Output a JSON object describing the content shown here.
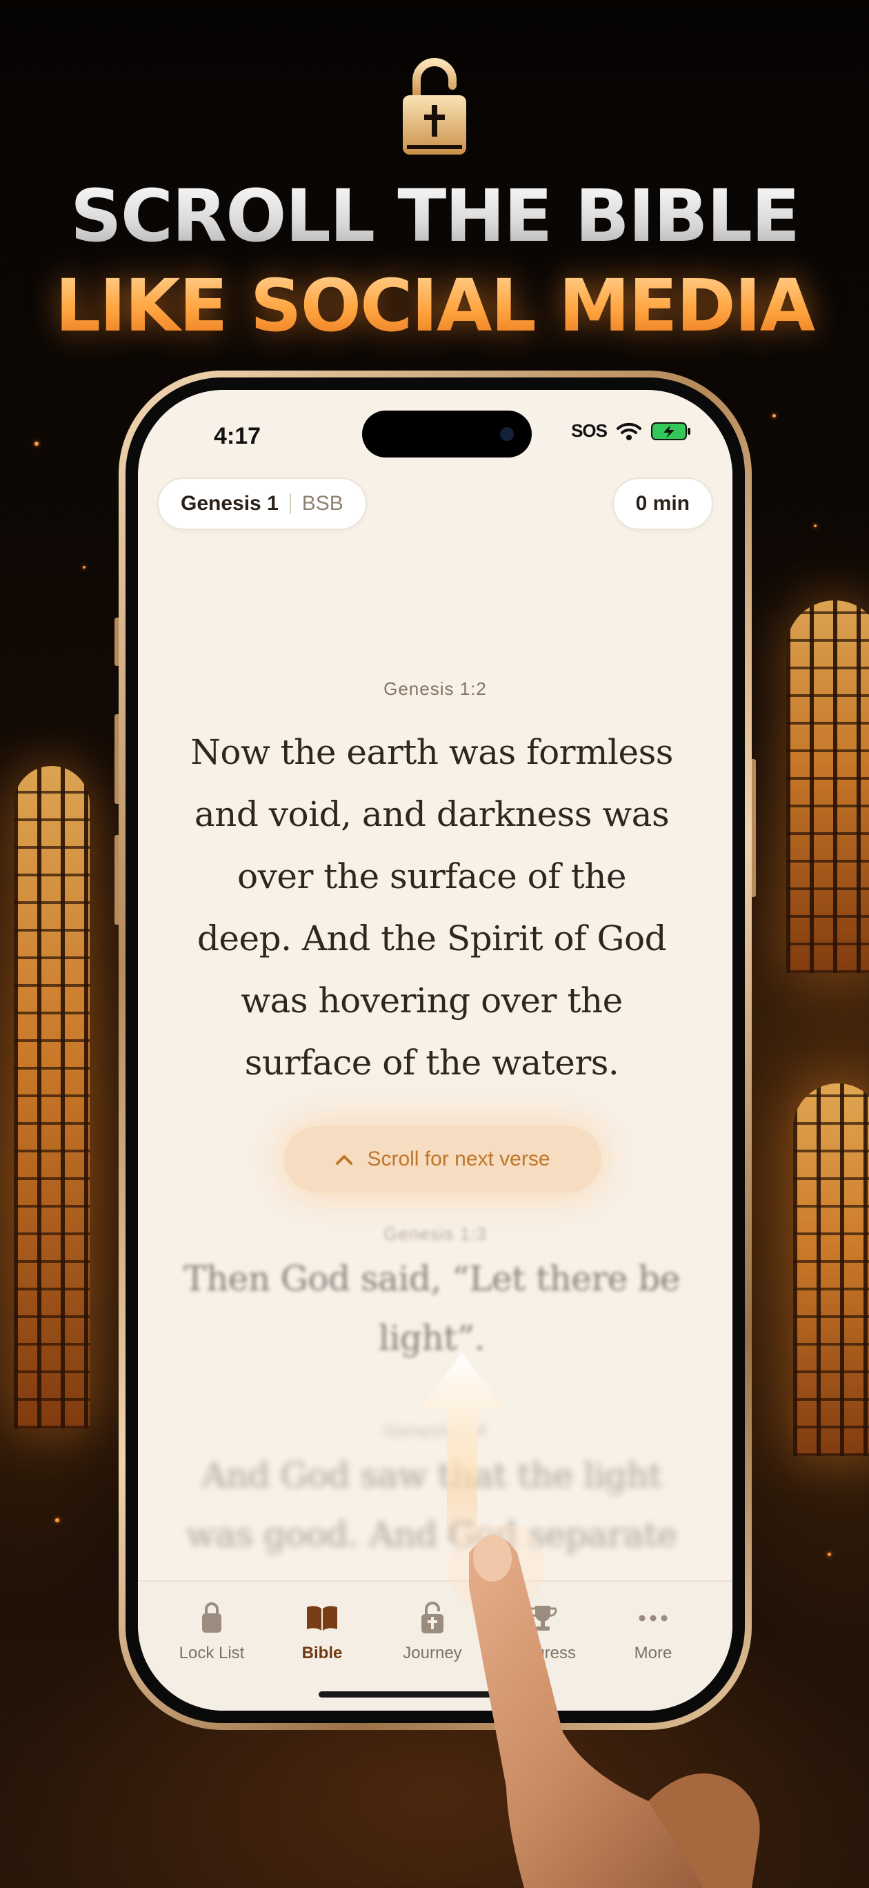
{
  "headline": {
    "line1": "SCROLL THE BIBLE",
    "line2": "LIKE SOCIAL MEDIA"
  },
  "status_bar": {
    "time": "4:17",
    "carrier": "SOS",
    "icons": [
      "wifi-icon",
      "battery-charging-icon"
    ]
  },
  "reader": {
    "book_chip": {
      "book": "Genesis 1",
      "version": "BSB"
    },
    "timer": "0 min",
    "verses": [
      {
        "ref": "Genesis 1:2",
        "lines": [
          "Now the earth was formless",
          "and void, and darkness was",
          "over the surface of the",
          "deep. And the Spirit of God",
          "was hovering over the",
          "surface of the waters."
        ]
      },
      {
        "ref": "Genesis 1:3",
        "lines": [
          "Then God said, “Let there be",
          "light”."
        ]
      },
      {
        "ref": "Genesis 1:4",
        "lines": [
          "And God saw that the light",
          "was good. And God separate"
        ]
      }
    ],
    "next_button": "Scroll for next verse"
  },
  "tabbar": {
    "items": [
      {
        "label": "Lock List",
        "icon": "lock-list-icon"
      },
      {
        "label": "Bible",
        "icon": "book-icon",
        "active": true
      },
      {
        "label": "Journey",
        "icon": "lock-cross-icon"
      },
      {
        "label": "Progress",
        "icon": "trophy-icon"
      },
      {
        "label": "More",
        "icon": "more-dots-icon"
      }
    ]
  },
  "colors": {
    "accent_orange": "#ffa43f",
    "screen_background": "#f8f1e8",
    "active_tab": "#6e3a16"
  }
}
